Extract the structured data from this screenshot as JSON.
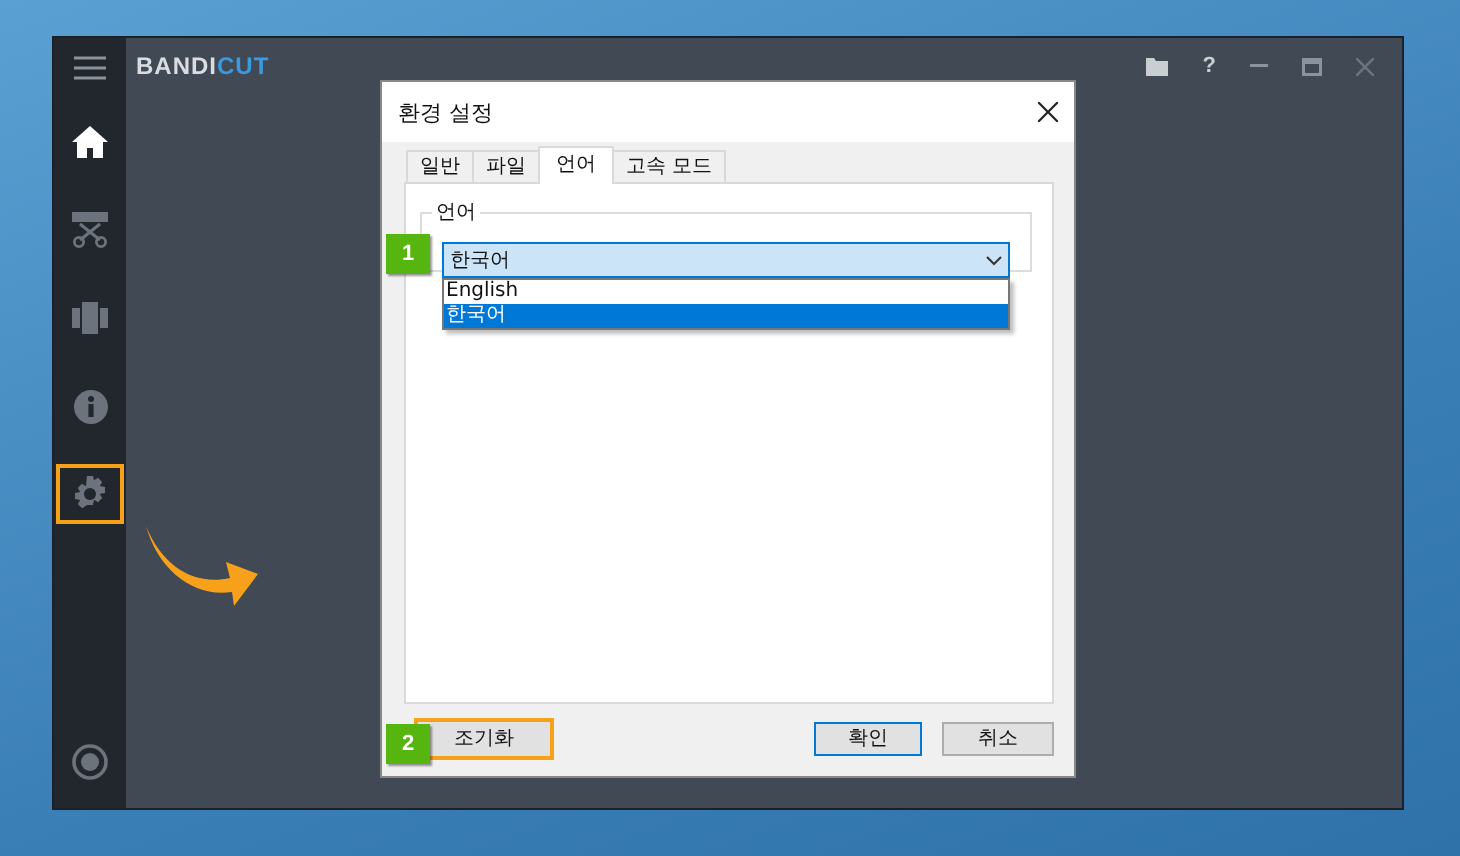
{
  "app": {
    "logo": {
      "main": "BANDI",
      "accent": "CUT"
    },
    "sidebar": {
      "items": [
        {
          "kind": "home",
          "selected": true,
          "highlighted": false
        },
        {
          "kind": "cut",
          "selected": false,
          "highlighted": false
        },
        {
          "kind": "join",
          "selected": false,
          "highlighted": false
        },
        {
          "kind": "info",
          "selected": false,
          "highlighted": false
        },
        {
          "kind": "settings",
          "selected": false,
          "highlighted": true
        }
      ],
      "bottom": {
        "kind": "record"
      }
    },
    "window_controls": [
      {
        "kind": "folder"
      },
      {
        "kind": "help",
        "text": "?"
      },
      {
        "kind": "minimize"
      },
      {
        "kind": "maximize"
      },
      {
        "kind": "close"
      }
    ]
  },
  "dialog": {
    "title": "환경 설정",
    "tabs": [
      {
        "label": "일반",
        "selected": false
      },
      {
        "label": "파일",
        "selected": false
      },
      {
        "label": "언어",
        "selected": true
      },
      {
        "label": "고속 모드",
        "selected": false
      }
    ],
    "group": {
      "label": "언어",
      "combo": {
        "value": "한국어",
        "expanded": true,
        "callout": "1",
        "options": [
          {
            "label": "English",
            "selected": false
          },
          {
            "label": "한국어",
            "selected": true
          }
        ]
      }
    },
    "buttons": [
      {
        "label": "조기화",
        "kind": "reset",
        "highlighted": true,
        "callout": "2"
      },
      {
        "label": "확인",
        "kind": "ok",
        "highlighted": false
      },
      {
        "label": "취소",
        "kind": "cancel",
        "highlighted": false
      }
    ]
  }
}
